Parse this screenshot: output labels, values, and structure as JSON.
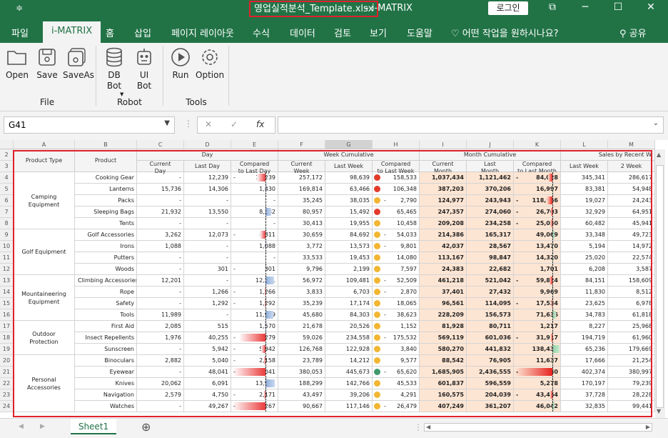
{
  "titlebar": {
    "file": "영업실적분석_Template.xlsx",
    "sep": "-",
    "app": "i-MATRIX",
    "login": "로그인",
    "qa": "≑"
  },
  "tabs": [
    "파일",
    "i-MATRIX",
    "홈",
    "삽입",
    "페이지 레이아웃",
    "수식",
    "데이터",
    "검토",
    "보기",
    "도움말",
    "어떤 작업을 원하시나요?",
    "공유"
  ],
  "ribbon": {
    "buttons": [
      {
        "label": "Open",
        "icon": "folder-icon"
      },
      {
        "label": "Save",
        "icon": "save-icon"
      },
      {
        "label": "SaveAs",
        "icon": "save-as-icon"
      },
      {
        "label": "DB\nBot",
        "icon": "database-icon"
      },
      {
        "label": "UI\nBot",
        "icon": "robot-icon"
      },
      {
        "label": "Run",
        "icon": "play-icon"
      },
      {
        "label": "Option",
        "icon": "gear-icon"
      }
    ],
    "groups": [
      "File",
      "Robot",
      "Tools"
    ]
  },
  "formula": {
    "namebox": "G41",
    "fx": "fx",
    "value": ""
  },
  "columns": [
    "A",
    "B",
    "C",
    "D",
    "E",
    "F",
    "G",
    "H",
    "I",
    "J",
    "K",
    "L",
    "M"
  ],
  "rows": [
    "2",
    "3",
    "4",
    "5",
    "6",
    "7",
    "8",
    "9",
    "10",
    "11",
    "12",
    "13",
    "14",
    "15",
    "16",
    "17",
    "18",
    "19",
    "20",
    "21",
    "22",
    "23",
    "24"
  ],
  "headers": {
    "product_type": "Product Type",
    "product": "Product",
    "day": "Day",
    "week": "Week Cumulative",
    "month": "Month Cumulative",
    "recent": "Sales by Recent W",
    "sub": [
      "Current\nDay",
      "Last Day",
      "Compared\nto Last Day",
      "Current\nWeek",
      "Last Week",
      "Compared\nto Last Week",
      "Current\nMonth",
      "Last\nMonth",
      "Compared\nto Last Month",
      "Last Week",
      "2 Week"
    ]
  },
  "groups": [
    {
      "name": "Camping\nEquipment",
      "rows": 5
    },
    {
      "name": "Golf Equipment",
      "rows": 4
    },
    {
      "name": "Mountaineering\nEquipment",
      "rows": 4
    },
    {
      "name": "Outdoor\nProtection",
      "rows": 3
    },
    {
      "name": "Personal\nAccessories",
      "rows": 5
    }
  ],
  "data": [
    {
      "p": "Cooking Gear",
      "c": "-",
      "ld": "12,239",
      "cmp": "12,239",
      "cw": "257,172",
      "lw": "98,639",
      "wd": "red",
      "cmw": "158,533",
      "cm": "1,037,434",
      "lm": "1,121,462",
      "cmm": "84,028",
      "lw2": "345,341",
      "w2": "286,617"
    },
    {
      "p": "Lanterns",
      "c": "15,736",
      "ld": "14,306",
      "cmp": "1,430",
      "cw": "169,814",
      "lw": "63,466",
      "wd": "red",
      "cmw": "106,348",
      "cm": "387,203",
      "lm": "370,206",
      "cmm": "16,997",
      "lw2": "83,381",
      "w2": "54,948"
    },
    {
      "p": "Packs",
      "c": "-",
      "ld": "-",
      "cmp": "-",
      "cw": "35,245",
      "lw": "38,035",
      "wd": "yellow",
      "cmw": "2,790",
      "cm": "124,977",
      "lm": "243,943",
      "cmm": "118,966",
      "lw2": "19,027",
      "w2": "24,243"
    },
    {
      "p": "Sleeping Bags",
      "c": "21,932",
      "ld": "13,550",
      "cmp": "8,382",
      "cw": "80,957",
      "lw": "15,492",
      "wd": "red",
      "cmw": "65,465",
      "cm": "247,357",
      "lm": "274,060",
      "cmm": "26,703",
      "lw2": "32,929",
      "w2": "64,951"
    },
    {
      "p": "Tents",
      "c": "-",
      "ld": "-",
      "cmp": "-",
      "cw": "30,413",
      "lw": "19,955",
      "wd": "yellow",
      "cmw": "10,458",
      "cm": "209,208",
      "lm": "234,258",
      "cmm": "25,050",
      "lw2": "60,482",
      "w2": "45,941"
    },
    {
      "p": "Golf Accessories",
      "c": "3,262",
      "ld": "12,073",
      "cmp": "8,811",
      "cw": "30,659",
      "lw": "84,692",
      "wd": "yellow",
      "cmw": "54,033",
      "cm": "214,386",
      "lm": "165,317",
      "cmm": "49,069",
      "lw2": "33,348",
      "w2": "49,723"
    },
    {
      "p": "Irons",
      "c": "1,088",
      "ld": "-",
      "cmp": "1,088",
      "cw": "3,772",
      "lw": "13,573",
      "wd": "yellow",
      "cmw": "9,801",
      "cm": "42,037",
      "lm": "28,567",
      "cmm": "13,470",
      "lw2": "5,194",
      "w2": "14,972"
    },
    {
      "p": "Putters",
      "c": "-",
      "ld": "-",
      "cmp": "-",
      "cw": "33,533",
      "lw": "19,453",
      "wd": "yellow",
      "cmw": "14,080",
      "cm": "113,167",
      "lm": "98,847",
      "cmm": "14,320",
      "lw2": "25,020",
      "w2": "22,574"
    },
    {
      "p": "Woods",
      "c": "-",
      "ld": "301",
      "cmp": "301",
      "cw": "9,796",
      "lw": "2,199",
      "wd": "yellow",
      "cmw": "7,597",
      "cm": "24,383",
      "lm": "22,682",
      "cmm": "1,701",
      "lw2": "6,208",
      "w2": "3,587"
    },
    {
      "p": "Climbing Accessories",
      "c": "12,201",
      "ld": "-",
      "cmp": "12,201",
      "cw": "56,972",
      "lw": "109,481",
      "wd": "yellow",
      "cmw": "52,509",
      "cm": "461,218",
      "lm": "521,042",
      "cmm": "59,824",
      "lw2": "84,151",
      "w2": "158,609"
    },
    {
      "p": "Rope",
      "c": "-",
      "ld": "1,266",
      "cmp": "1,266",
      "cw": "3,833",
      "lw": "6,703",
      "wd": "yellow",
      "cmw": "2,870",
      "cm": "37,401",
      "lm": "27,432",
      "cmm": "9,969",
      "lw2": "11,830",
      "w2": "8,512"
    },
    {
      "p": "Safety",
      "c": "-",
      "ld": "1,292",
      "cmp": "1,292",
      "cw": "35,239",
      "lw": "17,174",
      "wd": "yellow",
      "cmw": "18,065",
      "cm": "96,561",
      "lm": "114,095",
      "cmm": "17,534",
      "lw2": "23,625",
      "w2": "6,978"
    },
    {
      "p": "Tools",
      "c": "11,989",
      "ld": "-",
      "cmp": "11,989",
      "cw": "45,680",
      "lw": "84,303",
      "wd": "yellow",
      "cmw": "38,623",
      "cm": "228,209",
      "lm": "156,573",
      "cmm": "71,636",
      "lw2": "34,783",
      "w2": "61,818"
    },
    {
      "p": "First Aid",
      "c": "2,085",
      "ld": "515",
      "cmp": "1,570",
      "cw": "21,678",
      "lw": "20,526",
      "wd": "yellow",
      "cmw": "1,152",
      "cm": "81,928",
      "lm": "80,711",
      "cmm": "1,217",
      "lw2": "8,227",
      "w2": "25,968"
    },
    {
      "p": "Insect Repellents",
      "c": "1,976",
      "ld": "40,255",
      "cmp": "38,279",
      "cw": "59,026",
      "lw": "234,558",
      "wd": "yellow",
      "cmw": "175,532",
      "cm": "569,119",
      "lm": "601,036",
      "cmm": "31,917",
      "lw2": "194,719",
      "w2": "61,960"
    },
    {
      "p": "Sunscreen",
      "c": "-",
      "ld": "5,942",
      "cmp": "5,942",
      "cw": "126,768",
      "lw": "122,928",
      "wd": "yellow",
      "cmw": "3,840",
      "cm": "580,270",
      "lm": "441,832",
      "cmm": "138,438",
      "lw2": "65,236",
      "w2": "179,669"
    },
    {
      "p": "Binoculars",
      "c": "2,882",
      "ld": "5,040",
      "cmp": "2,158",
      "cw": "23,789",
      "lw": "14,212",
      "wd": "yellow",
      "cmw": "9,577",
      "cm": "88,542",
      "lm": "76,905",
      "cmm": "11,637",
      "lw2": "17,666",
      "w2": "21,254"
    },
    {
      "p": "Eyewear",
      "c": "-",
      "ld": "48,041",
      "cmp": "48,041",
      "cw": "380,053",
      "lw": "445,673",
      "wd": "green",
      "cmw": "65,620",
      "cm": "1,685,905",
      "lm": "2,436,555",
      "cmm": "750,650",
      "lw2": "402,374",
      "w2": "380,997"
    },
    {
      "p": "Knives",
      "c": "20,062",
      "ld": "6,091",
      "cmp": "13,971",
      "cw": "188,299",
      "lw": "142,766",
      "wd": "yellow",
      "cmw": "45,533",
      "cm": "601,837",
      "lm": "596,559",
      "cmm": "5,278",
      "lw2": "170,197",
      "w2": "79,239"
    },
    {
      "p": "Navigation",
      "c": "2,579",
      "ld": "4,750",
      "cmp": "2,171",
      "cw": "43,497",
      "lw": "39,206",
      "wd": "yellow",
      "cmw": "4,291",
      "cm": "160,575",
      "lm": "204,039",
      "cmm": "43,464",
      "lw2": "37,728",
      "w2": "28,228"
    },
    {
      "p": "Watches",
      "c": "-",
      "ld": "49,267",
      "cmp": "49,267",
      "cw": "90,667",
      "lw": "117,146",
      "wd": "yellow",
      "cmw": "26,479",
      "cm": "407,249",
      "lm": "361,207",
      "cmm": "46,042",
      "lw2": "32,835",
      "w2": "99,441"
    }
  ],
  "sheet": {
    "tab": "Sheet1",
    "add": "⊕"
  }
}
